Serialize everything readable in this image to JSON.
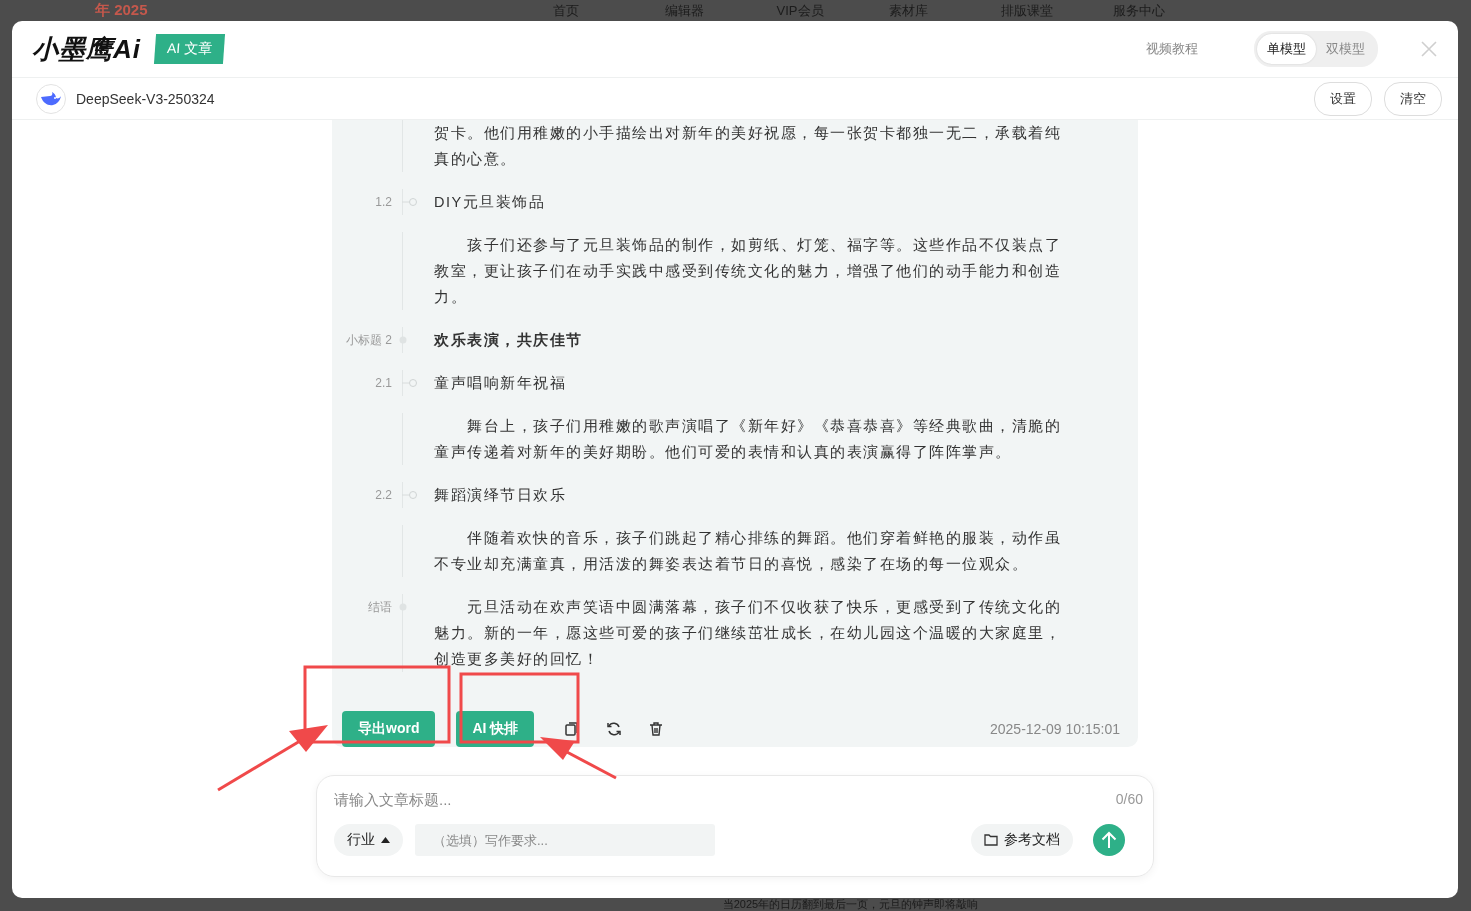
{
  "background": {
    "logo_text": "年 2025",
    "nav": [
      "首页",
      "编辑器",
      "VIP会员",
      "素材库",
      "排版课堂",
      "服务中心"
    ],
    "bottom_text": "当2025年的日历翻到最后一页，元旦的钟声即将敲响"
  },
  "header": {
    "logo": "小墨鹰Ai",
    "badge": "AI 文章",
    "tutorial_link": "视频教程",
    "mode_tabs": [
      {
        "label": "单模型",
        "selected": true
      },
      {
        "label": "双模型",
        "selected": false
      }
    ]
  },
  "model_bar": {
    "model_name": "DeepSeek-V3-250324",
    "buttons": [
      "设置",
      "清空"
    ]
  },
  "article": {
    "blocks": [
      {
        "kind": "paragraph",
        "indented": false,
        "text": "贺卡。他们用稚嫩的小手描绘出对新年的美好祝愿，每一张贺卡都独一无二，承载着纯真的心意。"
      },
      {
        "kind": "heading",
        "label": "1.2",
        "text": "DIY元旦装饰品"
      },
      {
        "kind": "paragraph",
        "indented": true,
        "text": "孩子们还参与了元旦装饰品的制作，如剪纸、灯笼、福字等。这些作品不仅装点了教室，更让孩子们在动手实践中感受到传统文化的魅力，增强了他们的动手能力和创造力。"
      },
      {
        "kind": "subtitle",
        "label": "小标题 2",
        "text": "欢乐表演，共庆佳节"
      },
      {
        "kind": "heading",
        "label": "2.1",
        "text": "童声唱响新年祝福"
      },
      {
        "kind": "paragraph",
        "indented": true,
        "text": "舞台上，孩子们用稚嫩的歌声演唱了《新年好》《恭喜恭喜》等经典歌曲，清脆的童声传递着对新年的美好期盼。他们可爱的表情和认真的表演赢得了阵阵掌声。"
      },
      {
        "kind": "heading",
        "label": "2.2",
        "text": "舞蹈演绎节日欢乐"
      },
      {
        "kind": "paragraph",
        "indented": true,
        "text": "伴随着欢快的音乐，孩子们跳起了精心排练的舞蹈。他们穿着鲜艳的服装，动作虽不专业却充满童真，用活泼的舞姿表达着节日的喜悦，感染了在场的每一位观众。"
      },
      {
        "kind": "paragraph",
        "label": "结语",
        "indented": true,
        "text": "元旦活动在欢声笑语中圆满落幕，孩子们不仅收获了快乐，更感受到了传统文化的魅力。新的一年，愿这些可爱的孩子们继续茁壮成长，在幼儿园这个温暖的大家庭里，创造更多美好的回忆！"
      }
    ],
    "actions": [
      "导出word",
      "AI 快排"
    ],
    "timestamp": "2025-12-09 10:15:01"
  },
  "composer": {
    "title_placeholder": "请输入文章标题...",
    "char_count": "0/60",
    "industry": "行业",
    "requirement_placeholder": "（选填）写作要求...",
    "reference_button": "参考文档"
  }
}
